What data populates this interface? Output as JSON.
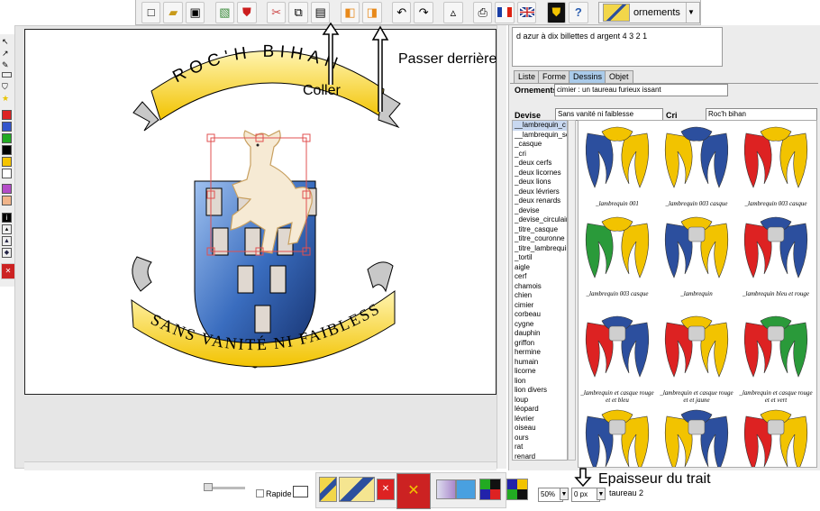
{
  "toolbar": {
    "ornaments_label": "ornements"
  },
  "annotations": {
    "coller": "Coller",
    "passer_derriere": "Passer derrière",
    "epaisseur": "Epaisseur du trait"
  },
  "blazon": {
    "motto_top": "ROC'H BIHAN",
    "motto_bottom": "SANS VANITÉ NI FAIBLESSE"
  },
  "right_panel": {
    "description": "d azur à dix billettes d argent 4 3 2 1",
    "tabs": [
      "Liste",
      "Forme",
      "Dessins",
      "Objet"
    ],
    "ornements_label": "Ornements",
    "ornements_value": "cimier : un taureau furieux issant",
    "devise_label": "Devise",
    "devise_value": "Sans vanité ni faiblesse",
    "cri_label": "Cri",
    "cri_value": "Roc'h bihan"
  },
  "list_items": [
    "__lambrequin_c",
    "__lambrequin_sc",
    "_casque",
    "_cri",
    "_deux cerfs",
    "_deux licornes",
    "_deux lions",
    "_deux lévriers",
    "_deux renards",
    "_devise",
    "_devise_circulaire",
    "_titre_casque",
    "_titre_couronne",
    "_titre_lambrequin",
    "_tortil",
    "aigle",
    "cerf",
    "chamois",
    "chien",
    "cimier",
    "corbeau",
    "cygne",
    "dauphin",
    "griffon",
    "hermine",
    "humain",
    "licorne",
    "lion",
    "lion divers",
    "loup",
    "léopard",
    "lévrier",
    "oiseau",
    "ours",
    "rat",
    "renard"
  ],
  "gallery": [
    "_lambrequin 001",
    "_lambrequin 003 casque",
    "_lambrequin 003 casque",
    "_lambrequin 003 casque",
    "_lambrequin",
    "_lambrequin bleu et rouge",
    "_lambrequin et casque rouge et et bleu",
    "_lambrequin et casque rouge et et jaune",
    "_lambrequin et casque rouge et et vert"
  ],
  "bottom": {
    "rapide_label": "Rapide",
    "zoom_value": "50%",
    "thickness_value": "0 px",
    "selection_label": "taureau 2"
  },
  "colors": {
    "shield_blue": "#3a6dbf",
    "ribbon_yellow": "#f5c800",
    "selected_tab": "#aacbea"
  }
}
